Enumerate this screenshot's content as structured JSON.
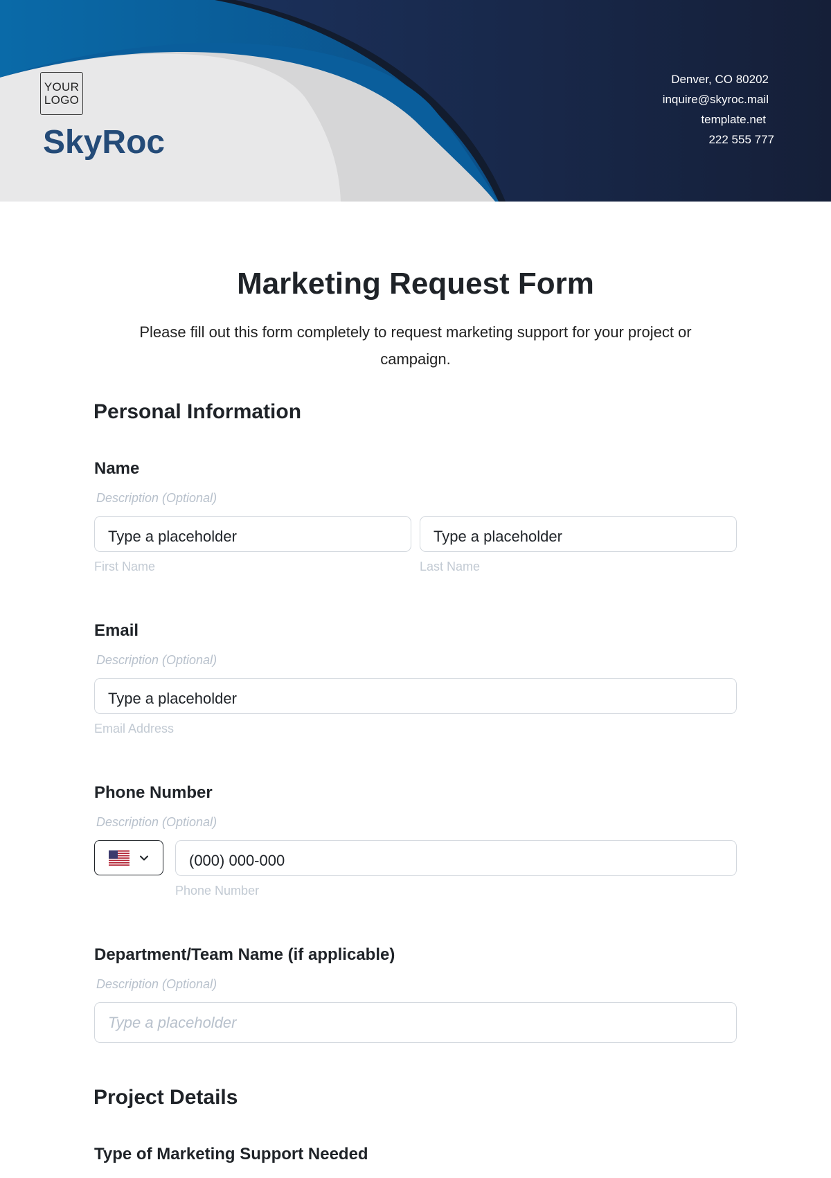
{
  "header": {
    "logo_line1": "YOUR",
    "logo_line2": "LOGO",
    "brand": "SkyRoc",
    "contact": [
      "Denver, CO 80202",
      "inquire@skyroc.mail",
      "template.net",
      "222 555 777"
    ]
  },
  "form": {
    "title": "Marketing Request Form",
    "intro": "Please fill out this form completely to request marketing support for your project or campaign.",
    "sections": {
      "personal": "Personal Information",
      "project": "Project Details"
    },
    "name": {
      "label": "Name",
      "description": "Description (Optional)",
      "first_value": "Type a placeholder",
      "first_sub": "First Name",
      "last_value": "Type a placeholder",
      "last_sub": "Last Name"
    },
    "email": {
      "label": "Email",
      "description": "Description (Optional)",
      "value": "Type a placeholder",
      "sub": "Email Address"
    },
    "phone": {
      "label": "Phone Number",
      "description": "Description (Optional)",
      "country_flag": "us-flag-icon",
      "value": "(000) 000-000",
      "sub": "Phone Number"
    },
    "department": {
      "label": "Department/Team Name (if applicable)",
      "description": "Description (Optional)",
      "placeholder": "Type a placeholder"
    },
    "support": {
      "label": "Type of Marketing Support Needed"
    }
  },
  "colors": {
    "header_dark": "#16213f",
    "header_blue": "#0066a8",
    "brand": "#244b78",
    "light_gray": "#e8e8e9"
  }
}
